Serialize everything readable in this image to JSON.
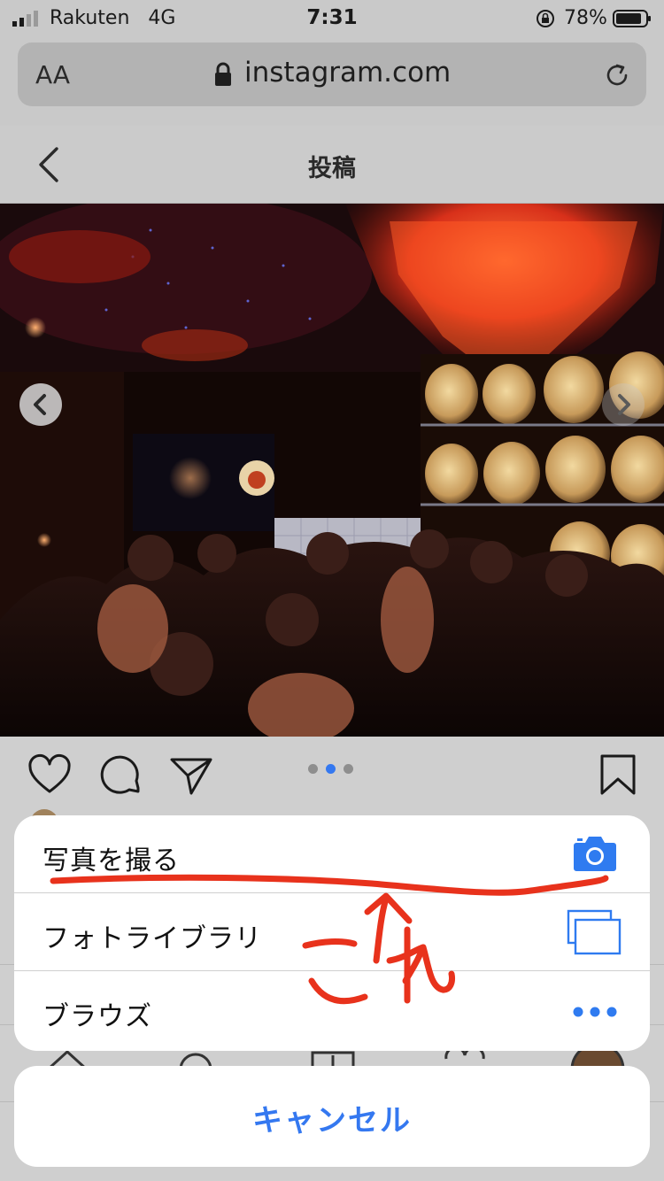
{
  "status_bar": {
    "carrier": "Rakuten",
    "network": "4G",
    "time": "7:31",
    "battery_percent": "78%"
  },
  "browser": {
    "text_size_label": "AA",
    "url": "instagram.com"
  },
  "page": {
    "title": "投稿"
  },
  "post": {
    "carousel_index": 2,
    "carousel_count": 3
  },
  "action_sheet": {
    "items": [
      {
        "label": "写真を撮る",
        "icon": "camera-icon"
      },
      {
        "label": "フォトライブラリ",
        "icon": "photo-library-icon"
      },
      {
        "label": "ブラウズ",
        "icon": "more-dots-icon"
      }
    ],
    "cancel_label": "キャンセル"
  },
  "annotation": {
    "handwritten_text": "これ"
  },
  "colors": {
    "accent": "#3478f0",
    "annotation": "#e8321c"
  }
}
